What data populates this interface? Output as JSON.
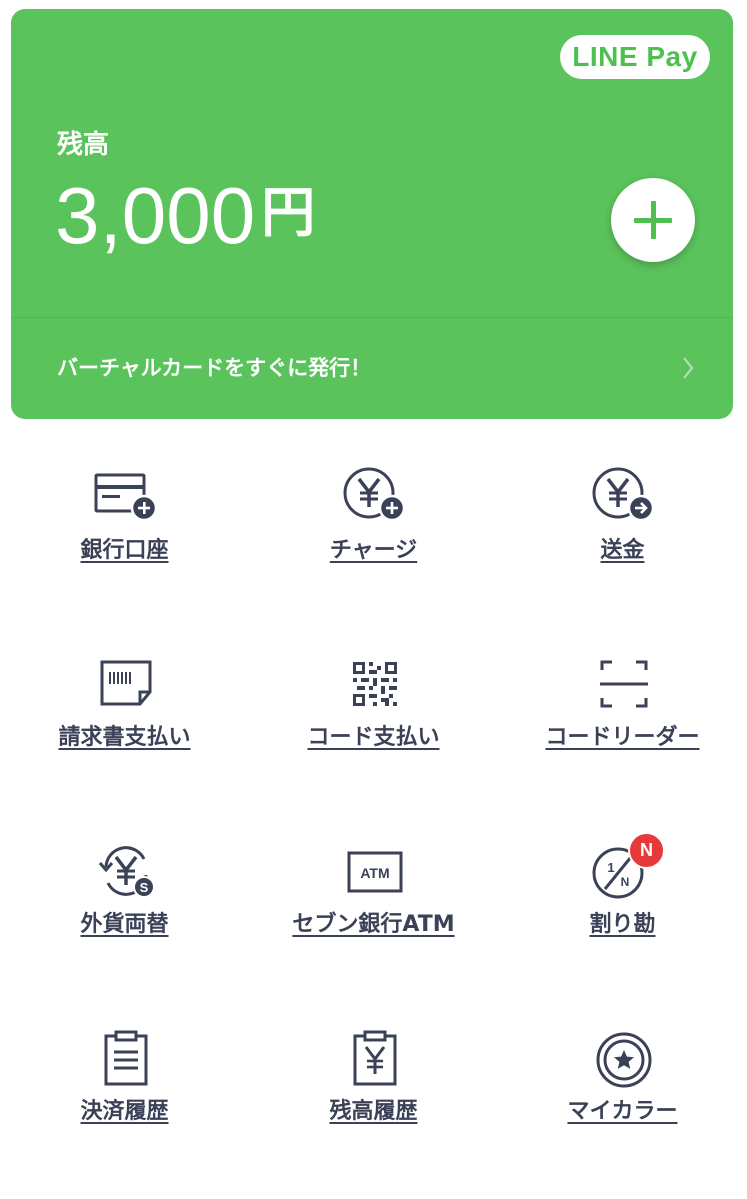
{
  "colors": {
    "brand_green": "#5ac35b",
    "icon_dark": "#3b4257",
    "badge_red": "#e8393a"
  },
  "wallet": {
    "brand": "LINE Pay",
    "balance_label": "残高",
    "balance_amount": "3,000",
    "currency": "円",
    "add_icon": "plus-icon",
    "promo_text": "バーチャルカードをすぐに発行！",
    "promo_icon": "chevron-right-icon"
  },
  "menu": {
    "bank_account": {
      "label": "銀行口座",
      "icon": "bank-card-plus-icon"
    },
    "charge": {
      "label": "チャージ",
      "icon": "yen-plus-icon"
    },
    "send": {
      "label": "送金",
      "icon": "yen-arrow-icon"
    },
    "bill_payment": {
      "label": "請求書支払い",
      "icon": "invoice-icon"
    },
    "code_payment": {
      "label": "コード支払い",
      "icon": "qr-code-icon"
    },
    "code_reader": {
      "label": "コードリーダー",
      "icon": "scan-frame-icon"
    },
    "currency_exchange": {
      "label": "外貨両替",
      "icon": "currency-exchange-icon"
    },
    "seven_atm": {
      "label": "セブン銀行ATM",
      "icon": "atm-icon",
      "icon_text": "ATM"
    },
    "split_bill": {
      "label": "割り勘",
      "icon": "split-bill-icon",
      "badge": "N"
    },
    "payment_history": {
      "label": "決済履歴",
      "icon": "clipboard-list-icon"
    },
    "balance_history": {
      "label": "残高履歴",
      "icon": "clipboard-yen-icon"
    },
    "my_color": {
      "label": "マイカラー",
      "icon": "star-medal-icon"
    }
  }
}
